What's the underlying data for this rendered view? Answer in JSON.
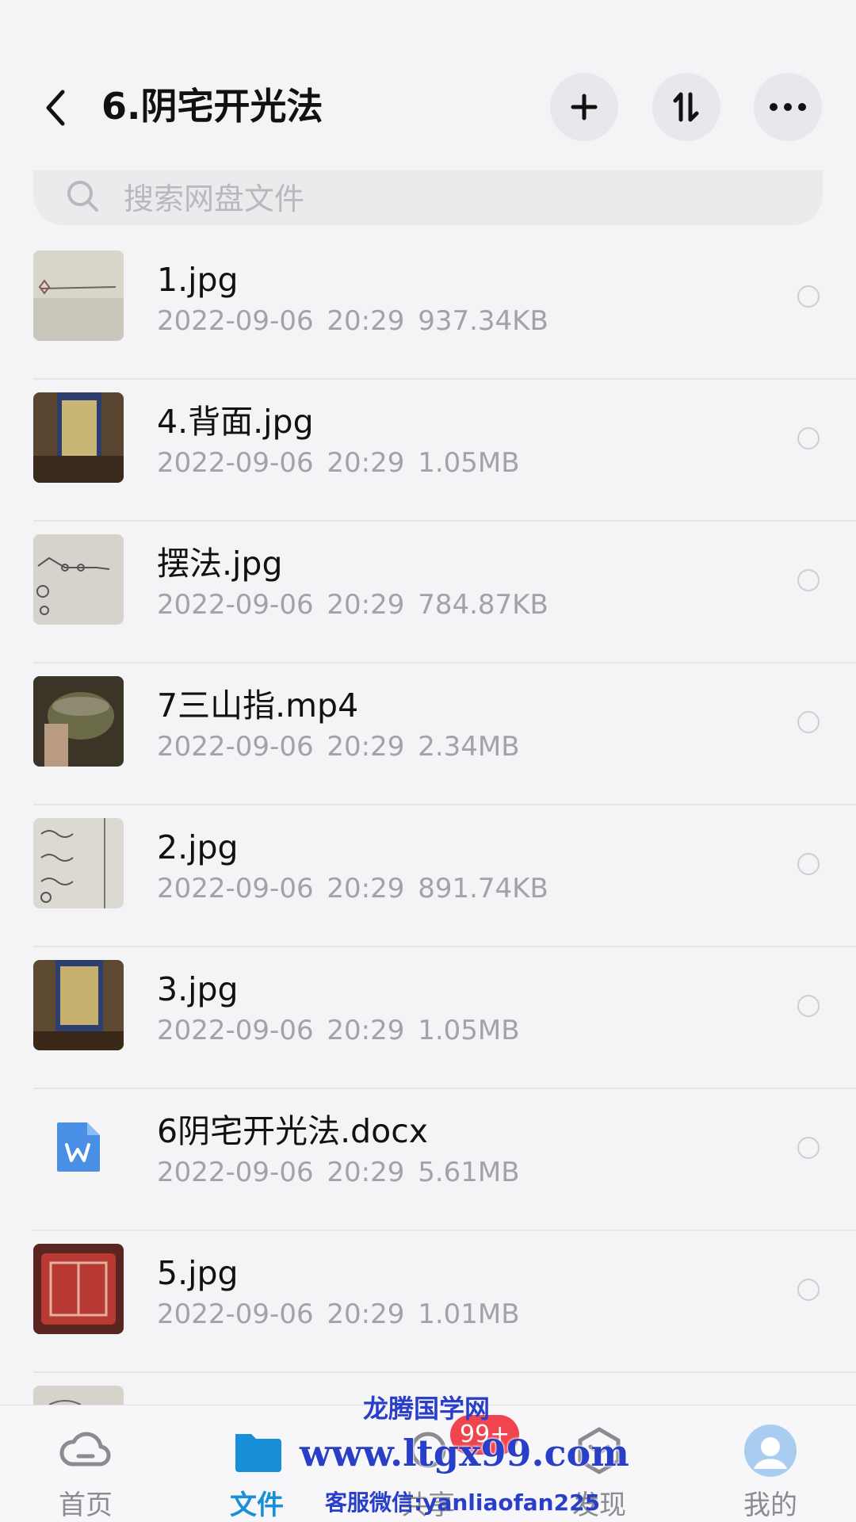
{
  "header": {
    "title": "6.阴宅开光法",
    "back_icon": "chevron-left-icon",
    "add_icon": "plus-icon",
    "sort_icon": "sort-icon",
    "more_icon": "more-dots-icon"
  },
  "search": {
    "placeholder": "搜索网盘文件",
    "icon": "search-icon"
  },
  "files": [
    {
      "name": "1.jpg",
      "date": "2022-09-06",
      "time": "20:29",
      "size": "937.34KB",
      "thumb": "image-thumbnail"
    },
    {
      "name": "4.背面.jpg",
      "date": "2022-09-06",
      "time": "20:29",
      "size": "1.05MB",
      "thumb": "image-thumbnail"
    },
    {
      "name": "摆法.jpg",
      "date": "2022-09-06",
      "time": "20:29",
      "size": "784.87KB",
      "thumb": "image-thumbnail"
    },
    {
      "name": "7三山指.mp4",
      "date": "2022-09-06",
      "time": "20:29",
      "size": "2.34MB",
      "thumb": "video-thumbnail"
    },
    {
      "name": "2.jpg",
      "date": "2022-09-06",
      "time": "20:29",
      "size": "891.74KB",
      "thumb": "image-thumbnail"
    },
    {
      "name": "3.jpg",
      "date": "2022-09-06",
      "time": "20:29",
      "size": "1.05MB",
      "thumb": "image-thumbnail"
    },
    {
      "name": "6阴宅开光法.docx",
      "date": "2022-09-06",
      "time": "20:29",
      "size": "5.61MB",
      "thumb": "word-doc-icon"
    },
    {
      "name": "5.jpg",
      "date": "2022-09-06",
      "time": "20:29",
      "size": "1.01MB",
      "thumb": "image-thumbnail"
    }
  ],
  "nav": {
    "home": "首页",
    "files": "文件",
    "share": "共享",
    "discover": "发现",
    "mine": "我的",
    "badge": "99+",
    "active": "files"
  },
  "watermark": {
    "line1": "龙腾国学网",
    "line2": "www.ltgx99.com",
    "line3": "客服微信:yanliaofan225"
  },
  "colors": {
    "accent": "#1a8fd9",
    "badge": "#f0444e",
    "background": "#f4f4f6",
    "watermark": "#2a3fc8"
  }
}
